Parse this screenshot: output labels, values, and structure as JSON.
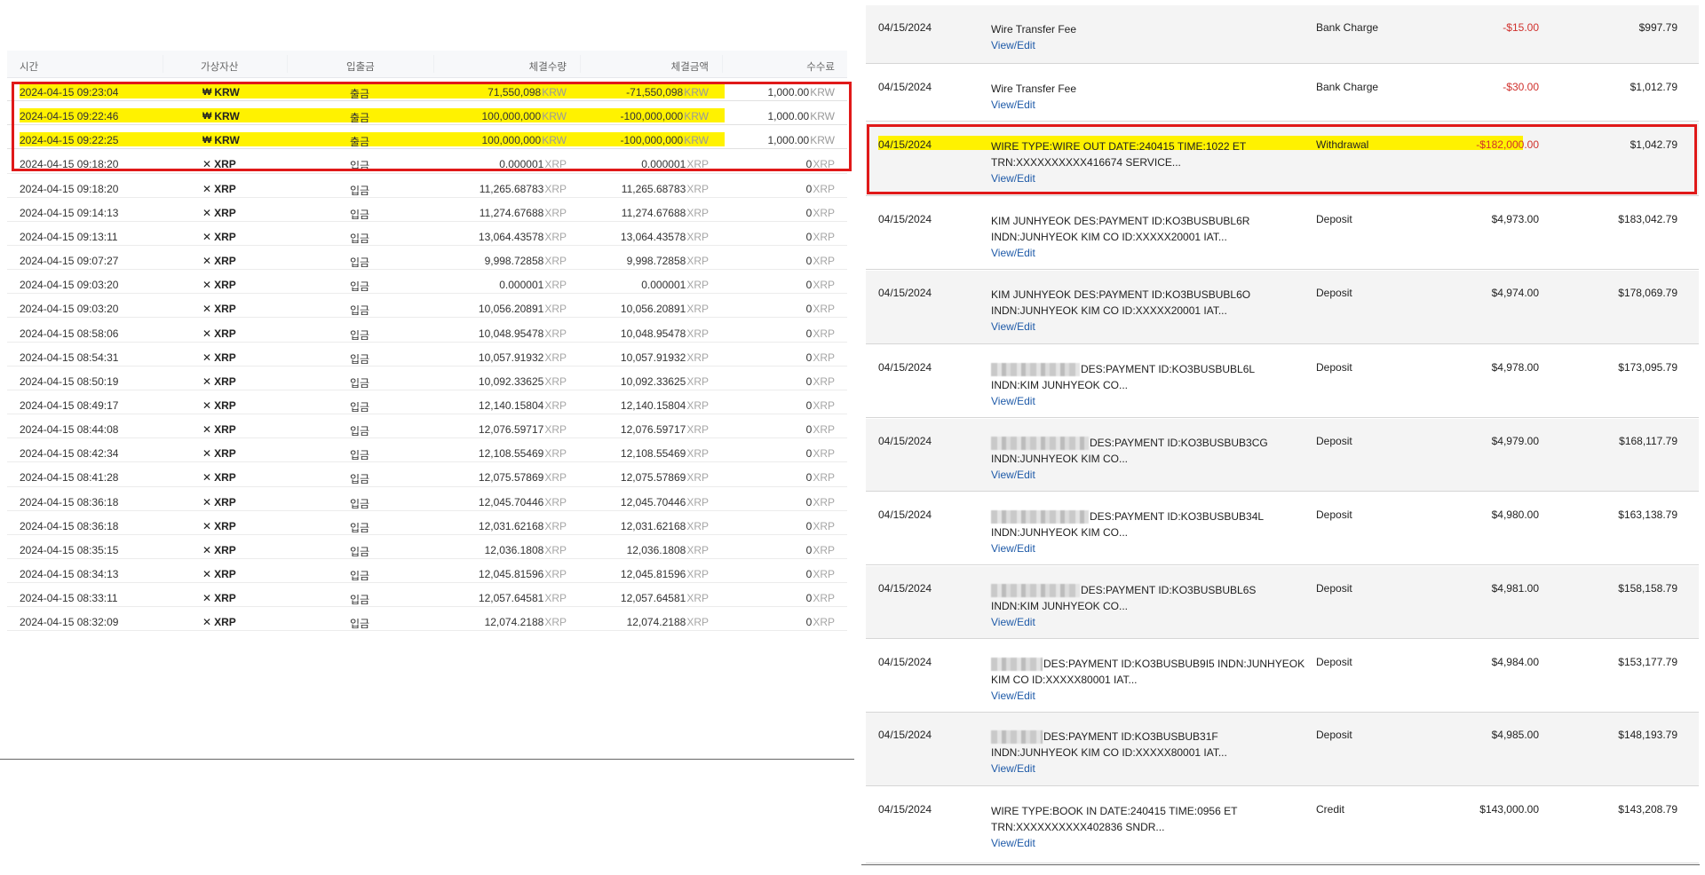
{
  "exchange": {
    "headers": {
      "time": "시간",
      "asset": "가상자산",
      "type": "입출금",
      "qty": "체결수량",
      "amount": "체결금액",
      "fee": "수수료"
    },
    "rows": [
      {
        "time": "2024-04-15 09:23:04",
        "asset": "KRW",
        "icon": "won-icon",
        "type": "출금",
        "qty": "71,550,098",
        "qty_unit": "KRW",
        "amount": "-71,550,098",
        "amount_unit": "KRW",
        "fee": "1,000.00",
        "fee_unit": "KRW",
        "highlight": true
      },
      {
        "time": "2024-04-15 09:22:46",
        "asset": "KRW",
        "icon": "won-icon",
        "type": "출금",
        "qty": "100,000,000",
        "qty_unit": "KRW",
        "amount": "-100,000,000",
        "amount_unit": "KRW",
        "fee": "1,000.00",
        "fee_unit": "KRW",
        "highlight": true
      },
      {
        "time": "2024-04-15 09:22:25",
        "asset": "KRW",
        "icon": "won-icon",
        "type": "출금",
        "qty": "100,000,000",
        "qty_unit": "KRW",
        "amount": "-100,000,000",
        "amount_unit": "KRW",
        "fee": "1,000.00",
        "fee_unit": "KRW",
        "highlight": true
      },
      {
        "time": "2024-04-15 09:18:20",
        "asset": "XRP",
        "icon": "xrp-icon",
        "type": "입금",
        "qty": "0.000001",
        "qty_unit": "XRP",
        "amount": "0.000001",
        "amount_unit": "XRP",
        "fee": "0",
        "fee_unit": "XRP"
      },
      {
        "time": "2024-04-15 09:18:20",
        "asset": "XRP",
        "icon": "xrp-icon",
        "type": "입금",
        "qty": "11,265.68783",
        "qty_unit": "XRP",
        "amount": "11,265.68783",
        "amount_unit": "XRP",
        "fee": "0",
        "fee_unit": "XRP"
      },
      {
        "time": "2024-04-15 09:14:13",
        "asset": "XRP",
        "icon": "xrp-icon",
        "type": "입금",
        "qty": "11,274.67688",
        "qty_unit": "XRP",
        "amount": "11,274.67688",
        "amount_unit": "XRP",
        "fee": "0",
        "fee_unit": "XRP"
      },
      {
        "time": "2024-04-15 09:13:11",
        "asset": "XRP",
        "icon": "xrp-icon",
        "type": "입금",
        "qty": "13,064.43578",
        "qty_unit": "XRP",
        "amount": "13,064.43578",
        "amount_unit": "XRP",
        "fee": "0",
        "fee_unit": "XRP"
      },
      {
        "time": "2024-04-15 09:07:27",
        "asset": "XRP",
        "icon": "xrp-icon",
        "type": "입금",
        "qty": "9,998.72858",
        "qty_unit": "XRP",
        "amount": "9,998.72858",
        "amount_unit": "XRP",
        "fee": "0",
        "fee_unit": "XRP"
      },
      {
        "time": "2024-04-15 09:03:20",
        "asset": "XRP",
        "icon": "xrp-icon",
        "type": "입금",
        "qty": "0.000001",
        "qty_unit": "XRP",
        "amount": "0.000001",
        "amount_unit": "XRP",
        "fee": "0",
        "fee_unit": "XRP"
      },
      {
        "time": "2024-04-15 09:03:20",
        "asset": "XRP",
        "icon": "xrp-icon",
        "type": "입금",
        "qty": "10,056.20891",
        "qty_unit": "XRP",
        "amount": "10,056.20891",
        "amount_unit": "XRP",
        "fee": "0",
        "fee_unit": "XRP"
      },
      {
        "time": "2024-04-15 08:58:06",
        "asset": "XRP",
        "icon": "xrp-icon",
        "type": "입금",
        "qty": "10,048.95478",
        "qty_unit": "XRP",
        "amount": "10,048.95478",
        "amount_unit": "XRP",
        "fee": "0",
        "fee_unit": "XRP"
      },
      {
        "time": "2024-04-15 08:54:31",
        "asset": "XRP",
        "icon": "xrp-icon",
        "type": "입금",
        "qty": "10,057.91932",
        "qty_unit": "XRP",
        "amount": "10,057.91932",
        "amount_unit": "XRP",
        "fee": "0",
        "fee_unit": "XRP"
      },
      {
        "time": "2024-04-15 08:50:19",
        "asset": "XRP",
        "icon": "xrp-icon",
        "type": "입금",
        "qty": "10,092.33625",
        "qty_unit": "XRP",
        "amount": "10,092.33625",
        "amount_unit": "XRP",
        "fee": "0",
        "fee_unit": "XRP"
      },
      {
        "time": "2024-04-15 08:49:17",
        "asset": "XRP",
        "icon": "xrp-icon",
        "type": "입금",
        "qty": "12,140.15804",
        "qty_unit": "XRP",
        "amount": "12,140.15804",
        "amount_unit": "XRP",
        "fee": "0",
        "fee_unit": "XRP"
      },
      {
        "time": "2024-04-15 08:44:08",
        "asset": "XRP",
        "icon": "xrp-icon",
        "type": "입금",
        "qty": "12,076.59717",
        "qty_unit": "XRP",
        "amount": "12,076.59717",
        "amount_unit": "XRP",
        "fee": "0",
        "fee_unit": "XRP"
      },
      {
        "time": "2024-04-15 08:42:34",
        "asset": "XRP",
        "icon": "xrp-icon",
        "type": "입금",
        "qty": "12,108.55469",
        "qty_unit": "XRP",
        "amount": "12,108.55469",
        "amount_unit": "XRP",
        "fee": "0",
        "fee_unit": "XRP"
      },
      {
        "time": "2024-04-15 08:41:28",
        "asset": "XRP",
        "icon": "xrp-icon",
        "type": "입금",
        "qty": "12,075.57869",
        "qty_unit": "XRP",
        "amount": "12,075.57869",
        "amount_unit": "XRP",
        "fee": "0",
        "fee_unit": "XRP"
      },
      {
        "time": "2024-04-15 08:36:18",
        "asset": "XRP",
        "icon": "xrp-icon",
        "type": "입금",
        "qty": "12,045.70446",
        "qty_unit": "XRP",
        "amount": "12,045.70446",
        "amount_unit": "XRP",
        "fee": "0",
        "fee_unit": "XRP"
      },
      {
        "time": "2024-04-15 08:36:18",
        "asset": "XRP",
        "icon": "xrp-icon",
        "type": "입금",
        "qty": "12,031.62168",
        "qty_unit": "XRP",
        "amount": "12,031.62168",
        "amount_unit": "XRP",
        "fee": "0",
        "fee_unit": "XRP"
      },
      {
        "time": "2024-04-15 08:35:15",
        "asset": "XRP",
        "icon": "xrp-icon",
        "type": "입금",
        "qty": "12,036.1808",
        "qty_unit": "XRP",
        "amount": "12,036.1808",
        "amount_unit": "XRP",
        "fee": "0",
        "fee_unit": "XRP"
      },
      {
        "time": "2024-04-15 08:34:13",
        "asset": "XRP",
        "icon": "xrp-icon",
        "type": "입금",
        "qty": "12,045.81596",
        "qty_unit": "XRP",
        "amount": "12,045.81596",
        "amount_unit": "XRP",
        "fee": "0",
        "fee_unit": "XRP"
      },
      {
        "time": "2024-04-15 08:33:11",
        "asset": "XRP",
        "icon": "xrp-icon",
        "type": "입금",
        "qty": "12,057.64581",
        "qty_unit": "XRP",
        "amount": "12,057.64581",
        "amount_unit": "XRP",
        "fee": "0",
        "fee_unit": "XRP"
      },
      {
        "time": "2024-04-15 08:32:09",
        "asset": "XRP",
        "icon": "xrp-icon",
        "type": "입금",
        "qty": "12,074.2188",
        "qty_unit": "XRP",
        "amount": "12,074.2188",
        "amount_unit": "XRP",
        "fee": "0",
        "fee_unit": "XRP"
      }
    ]
  },
  "bank": {
    "edit_label": "View/Edit",
    "rows": [
      {
        "date": "04/15/2024",
        "lines": [
          "Wire Transfer Fee"
        ],
        "category": "Bank Charge",
        "amount": "-$15.00",
        "negative": true,
        "balance": "$997.79"
      },
      {
        "date": "04/15/2024",
        "lines": [
          "Wire Transfer Fee"
        ],
        "category": "Bank Charge",
        "amount": "-$30.00",
        "negative": true,
        "balance": "$1,012.79"
      },
      {
        "date": "04/15/2024",
        "lines": [
          "WIRE TYPE:WIRE OUT DATE:240415 TIME:1022 ET",
          "TRN:XXXXXXXXXX416674 SERVICE..."
        ],
        "category": "Withdrawal",
        "amount": "-$182,000.00",
        "negative": true,
        "balance": "$1,042.79",
        "highlight": true
      },
      {
        "date": "04/15/2024",
        "lines": [
          "KIM JUNHYEOK DES:PAYMENT ID:KO3BUSBUBL6R",
          "INDN:JUNHYEOK KIM CO ID:XXXXX20001 IAT..."
        ],
        "category": "Deposit",
        "amount": "$4,973.00",
        "balance": "$183,042.79"
      },
      {
        "date": "04/15/2024",
        "lines": [
          "KIM JUNHYEOK DES:PAYMENT ID:KO3BUSBUBL6O",
          "INDN:JUNHYEOK KIM CO ID:XXXXX20001 IAT..."
        ],
        "category": "Deposit",
        "amount": "$4,974.00",
        "balance": "$178,069.79"
      },
      {
        "date": "04/15/2024",
        "lines": [
          "DES:PAYMENT ID:KO3BUSBUBL6L",
          "INDN:KIM JUNHYEOK CO..."
        ],
        "redact_width": 100,
        "category": "Deposit",
        "amount": "$4,978.00",
        "balance": "$173,095.79"
      },
      {
        "date": "04/15/2024",
        "lines": [
          "DES:PAYMENT ID:KO3BUSBUB3CG",
          "INDN:JUNHYEOK KIM CO..."
        ],
        "redact_width": 110,
        "category": "Deposit",
        "amount": "$4,979.00",
        "balance": "$168,117.79"
      },
      {
        "date": "04/15/2024",
        "lines": [
          "DES:PAYMENT ID:KO3BUSBUB34L",
          "INDN:JUNHYEOK KIM CO..."
        ],
        "redact_width": 110,
        "category": "Deposit",
        "amount": "$4,980.00",
        "balance": "$163,138.79"
      },
      {
        "date": "04/15/2024",
        "lines": [
          "DES:PAYMENT ID:KO3BUSBUBL6S",
          "INDN:KIM JUNHYEOK CO..."
        ],
        "redact_width": 100,
        "category": "Deposit",
        "amount": "$4,981.00",
        "balance": "$158,158.79"
      },
      {
        "date": "04/15/2024",
        "lines": [
          "DES:PAYMENT ID:KO3BUSBUB9I5 INDN:JUNHYEOK",
          "KIM CO ID:XXXXX80001 IAT..."
        ],
        "redact_width": 58,
        "category": "Deposit",
        "amount": "$4,984.00",
        "balance": "$153,177.79"
      },
      {
        "date": "04/15/2024",
        "lines": [
          "DES:PAYMENT ID:KO3BUSBUB31F",
          "INDN:JUNHYEOK KIM CO ID:XXXXX80001 IAT..."
        ],
        "redact_width": 58,
        "category": "Deposit",
        "amount": "$4,985.00",
        "balance": "$148,193.79"
      },
      {
        "date": "04/15/2024",
        "lines": [
          "WIRE TYPE:BOOK IN DATE:240415 TIME:0956 ET",
          "TRN:XXXXXXXXXX402836 SNDR..."
        ],
        "category": "Credit",
        "amount": "$143,000.00",
        "balance": "$143,208.79"
      }
    ]
  }
}
